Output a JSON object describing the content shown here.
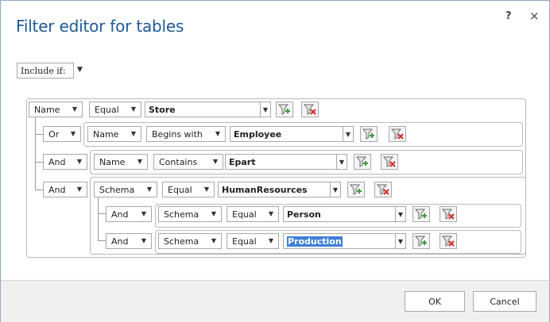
{
  "dialog": {
    "title": "Filter editor for tables",
    "help": "?",
    "close": "×"
  },
  "include": {
    "label": "Include if:",
    "arrow": "▼"
  },
  "rows": {
    "r0": {
      "field": "Name",
      "op": "Equal",
      "value": "Store"
    },
    "r1": {
      "logic": "Or",
      "field": "Name",
      "op": "Begins with",
      "value": "Employee"
    },
    "r2": {
      "logic": "And",
      "field": "Name",
      "op": "Contains",
      "value": "Epart"
    },
    "r3": {
      "logic": "And",
      "field": "Schema",
      "op": "Equal",
      "value": "HumanResources"
    },
    "r4": {
      "logic": "And",
      "field": "Schema",
      "op": "Equal",
      "value": "Person"
    },
    "r5": {
      "logic": "And",
      "field": "Schema",
      "op": "Equal",
      "value": "Production"
    }
  },
  "icons": {
    "add": "add-filter-icon",
    "remove": "remove-filter-icon",
    "arrow": "▼"
  },
  "footer": {
    "ok": "OK",
    "cancel": "Cancel"
  },
  "colors": {
    "title": "#1f5a96",
    "selection": "#3d7fd6",
    "add_green": "#3c9a3c",
    "remove_red": "#d42a2a"
  }
}
